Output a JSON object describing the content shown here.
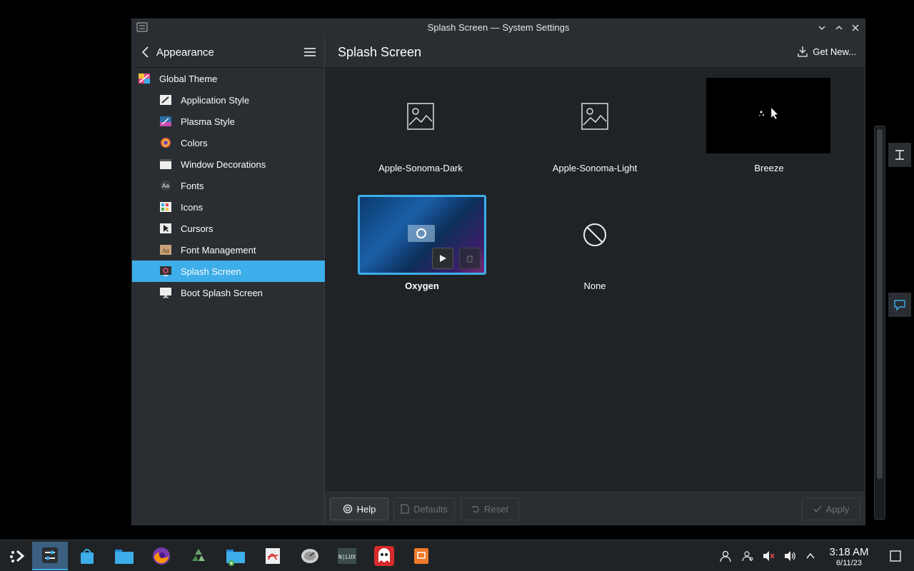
{
  "window": {
    "title": "Splash Screen — System Settings"
  },
  "sidebar": {
    "header_label": "Appearance",
    "items": [
      {
        "label": "Global Theme"
      },
      {
        "label": "Application Style"
      },
      {
        "label": "Plasma Style"
      },
      {
        "label": "Colors"
      },
      {
        "label": "Window Decorations"
      },
      {
        "label": "Fonts"
      },
      {
        "label": "Icons"
      },
      {
        "label": "Cursors"
      },
      {
        "label": "Font Management"
      },
      {
        "label": "Splash Screen",
        "selected": true
      },
      {
        "label": "Boot Splash Screen"
      }
    ]
  },
  "main": {
    "page_title": "Splash Screen",
    "get_new_label": "Get New...",
    "themes": [
      {
        "name": "Apple-Sonoma-Dark",
        "preview": "image-placeholder-icon"
      },
      {
        "name": "Apple-Sonoma-Light",
        "preview": "image-placeholder-icon"
      },
      {
        "name": "Breeze",
        "preview": "black-loading-preview"
      },
      {
        "name": "Oxygen",
        "preview": "blue-wallpaper-preview",
        "selected": true
      },
      {
        "name": "None",
        "preview": "no-entry-icon"
      }
    ]
  },
  "footer": {
    "help_label": "Help",
    "defaults_label": "Defaults",
    "reset_label": "Reset",
    "apply_label": "Apply"
  },
  "taskbar": {
    "time": "3:18 AM",
    "date": "6/11/23"
  },
  "colors": {
    "accent": "#3daee9",
    "window_bg": "#202326",
    "panel_bg": "#2a2e32"
  }
}
